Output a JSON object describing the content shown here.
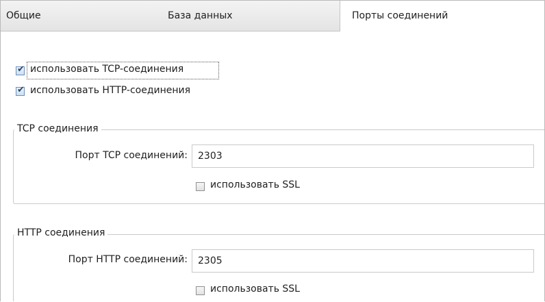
{
  "tabs": [
    {
      "label": "Общие",
      "active": false
    },
    {
      "label": "База данных",
      "active": false
    },
    {
      "label": "Порты соединений",
      "active": true
    }
  ],
  "options": {
    "use_tcp": {
      "label": "использовать TCP-соединения",
      "checked": true
    },
    "use_http": {
      "label": "использовать HTTP-соединения",
      "checked": true
    }
  },
  "tcp_group": {
    "title": "TCP соединения",
    "port_label": "Порт TCP соединений:",
    "port_value": "2303",
    "ssl_label": "использовать SSL",
    "ssl_checked": false
  },
  "http_group": {
    "title": "HTTP соединения",
    "port_label": "Порт HTTP соединений:",
    "port_value": "2305",
    "ssl_label": "использовать SSL",
    "ssl_checked": false
  },
  "icons": {
    "checkmark": "check-icon"
  }
}
